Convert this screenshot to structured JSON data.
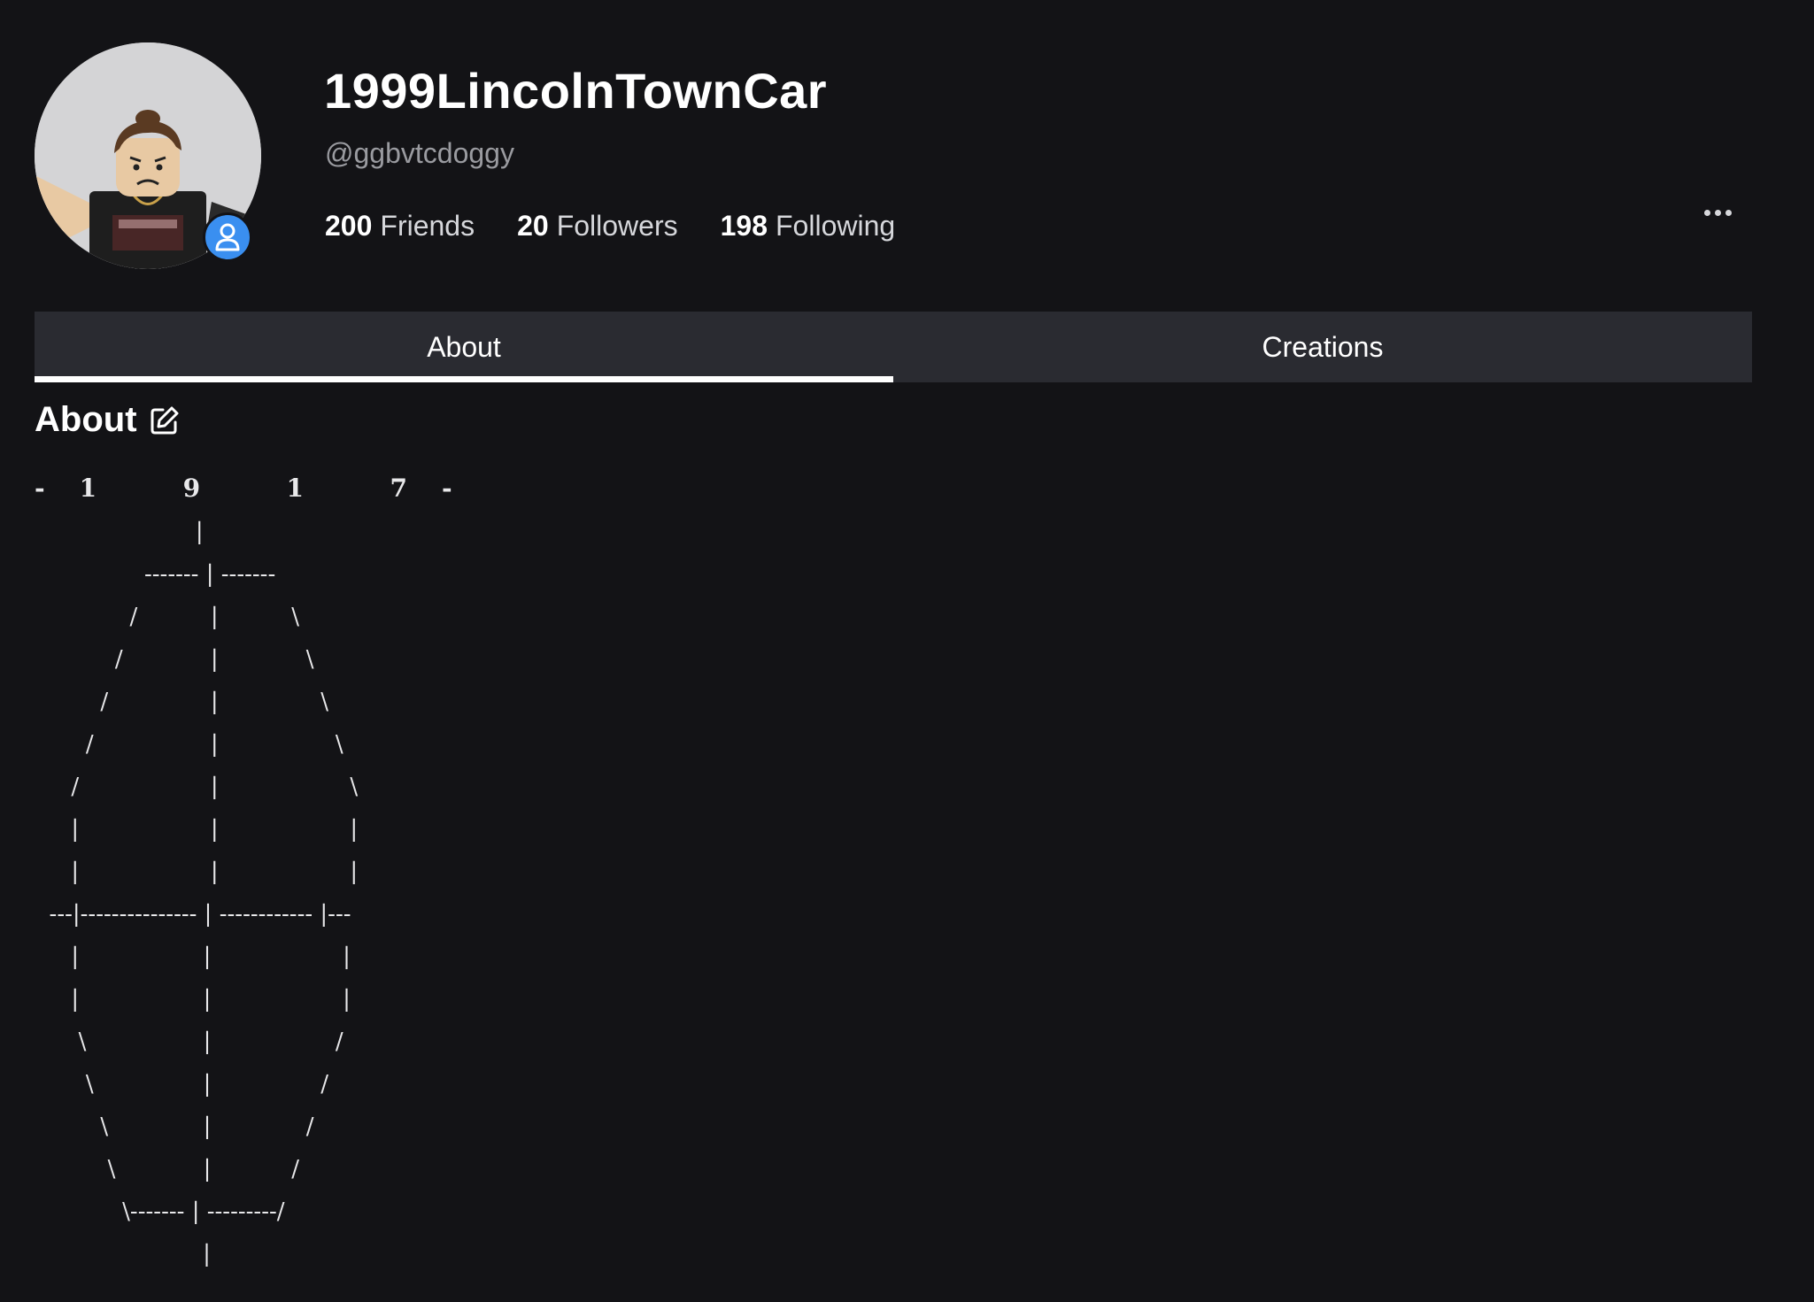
{
  "profile": {
    "display_name": "1999LincolnTownCar",
    "username": "@ggbvtcdoggy",
    "avatar_icon": "avatar-image",
    "presence_icon": "person-icon",
    "presence_color": "#3a8ff0"
  },
  "stats": [
    {
      "value": "200",
      "label": "Friends"
    },
    {
      "value": "20",
      "label": "Followers"
    },
    {
      "value": "198",
      "label": "Following"
    }
  ],
  "menu": {
    "more_icon": "more-horizontal-icon"
  },
  "tabs": [
    {
      "label": "About",
      "active": true
    },
    {
      "label": "Creations",
      "active": false
    }
  ],
  "about": {
    "heading": "About",
    "edit_icon": "edit-icon",
    "first_line": "-    1          9          1          7    -",
    "art": "                      |\n               ------- | -------\n             /          |          \\\n           /            |            \\\n         /              |              \\\n       /                |                \\\n     /                  |                  \\\n     |                  |                  |\n     |                  |                  |\n  ---|--------------- | ------------ |---\n     |                 |                  |\n     |                 |                  |\n      \\                |                 /\n       \\               |               /\n         \\             |             /\n          \\            |           /\n            \\------- | ---------/\n                       |"
  },
  "colors": {
    "background": "#131316",
    "tab_bar": "#2a2b31",
    "muted_text": "#9a9ba0"
  }
}
